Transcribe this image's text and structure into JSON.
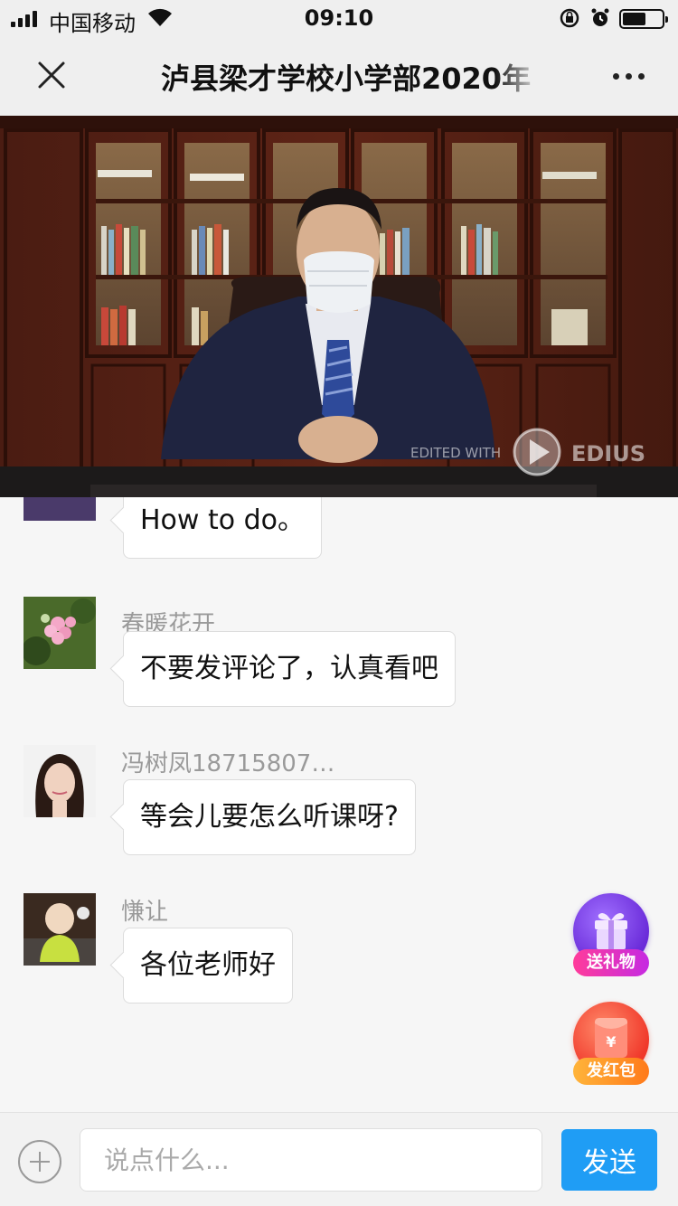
{
  "status_bar": {
    "carrier": "中国移动",
    "time": "09:10",
    "battery_level": 0.6
  },
  "nav": {
    "title": "泸县梁才学校小学部2020年",
    "close_icon": "close-icon",
    "more_icon": "more-icon"
  },
  "video": {
    "watermark": "EDITED WITH",
    "watermark_brand": "EDIUS"
  },
  "messages": [
    {
      "sender": "",
      "text": "How to do。"
    },
    {
      "sender": "春暖花开",
      "text": "不要发评论了，认真看吧"
    },
    {
      "sender": "冯树凤18715807…",
      "text": "等会儿要怎么听课呀?"
    },
    {
      "sender": "慊让",
      "text": "各位老师好"
    }
  ],
  "floating": {
    "gift_label": "送礼物",
    "redpack_label": "发红包",
    "redpack_symbol": "¥"
  },
  "input_bar": {
    "placeholder": "说点什么...",
    "send_label": "发送"
  },
  "colors": {
    "send_button": "#1f9df5",
    "gift_purple": "#7a3ff0",
    "redpack_red": "#f0382a"
  }
}
